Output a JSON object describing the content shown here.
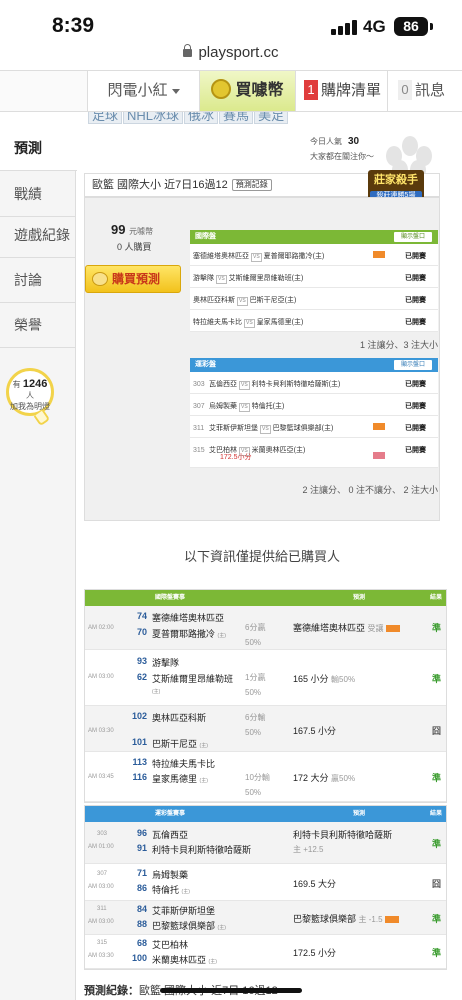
{
  "status": {
    "time": "8:39",
    "network": "4G",
    "battery": "86"
  },
  "browser": {
    "url": "playsport.cc"
  },
  "nav": {
    "user": "閃電小紅",
    "buy": "買噱幣",
    "cart_count": "1",
    "cart": "購牌清單",
    "msg_count": "0",
    "msg": "訊息"
  },
  "sport_tags": [
    "足球",
    "NHL冰球",
    "俄冰",
    "賽馬",
    "美足"
  ],
  "sidebar": {
    "items": [
      "預測",
      "戰績",
      "遊戲紀錄",
      "討論",
      "榮譽"
    ],
    "bulb_prefix": "有",
    "bulb_count": "1246",
    "bulb_suffix": "人",
    "bulb_text": "加我為明燈"
  },
  "header": {
    "visitors_label": "今日人氣",
    "visitors_count": "30",
    "visitors_sub": "大家都在關注你～"
  },
  "prediction": {
    "title": "歐籃 國際大小 近7日16過12",
    "tag": "預測記錄",
    "champion": "莊家殺手",
    "champion_sub": "殺莊連勝5場",
    "price": "99",
    "price_unit": "元噱幣",
    "bought": "0 人購買",
    "buy_button": "購買預測"
  },
  "intl_box": {
    "title": "國際盤",
    "button": "顯示盤口",
    "rows": [
      {
        "away": "塞德維塔奧林匹亞",
        "home": "夏普爾耶路撒冷(主)",
        "status": "已開賽",
        "mini": true
      },
      {
        "away": "游擊隊",
        "home": "艾斯維爾里昂維勒班(主)",
        "status": "已開賽",
        "mini": false
      },
      {
        "away": "奧林匹亞科斯",
        "home": "巴斯干尼亞(主)",
        "status": "已開賽",
        "mini": false
      },
      {
        "away": "特拉維夫馬卡比",
        "home": "皇家馬德里(主)",
        "status": "已開賽",
        "mini": false
      }
    ],
    "summary": "1 注讓分、3 注大小"
  },
  "lottery_box": {
    "title": "運彩盤",
    "button": "顯示盤口",
    "rows": [
      {
        "num": "303",
        "away": "瓦倫西亞",
        "home": "利特卡貝利斯特徹哈薩斯(主)",
        "status": "已開賽",
        "mini": false,
        "extra": ""
      },
      {
        "num": "307",
        "away": "烏姆製藥",
        "home": "特倫托(主)",
        "status": "已開賽",
        "mini": false,
        "extra": ""
      },
      {
        "num": "311",
        "away": "艾菲斯伊斯坦堡",
        "home": "巴黎籃球俱樂部(主)",
        "status": "已開賽",
        "mini": true,
        "extra": ""
      },
      {
        "num": "315",
        "away": "艾巴柏林",
        "home": "米蘭奧林匹亞(主)",
        "status": "已開賽",
        "mini": true,
        "extra": "172.5小分"
      }
    ],
    "summary": "2 注讓分、 0 注不讓分、 2 注大小"
  },
  "info_line": "以下資訊僅提供給已購買人",
  "intl_table": {
    "headers": [
      "國際盤賽事",
      "預測",
      "結果"
    ],
    "rows": [
      {
        "time": "AM 02:00",
        "n1": "74",
        "t1": "塞德維塔奧林匹亞",
        "n2": "70",
        "t2": "夏普爾耶路撒冷",
        "t2tag": "(主)",
        "hc1": "6分贏",
        "hc2": "50%",
        "pred": "塞德維塔奧林匹亞",
        "pred_extra": "受讓",
        "tag": true,
        "result": "準"
      },
      {
        "time": "AM 03:00",
        "n1": "93",
        "t1": "游擊隊",
        "n2": "62",
        "t2": "艾斯維爾里昂維勒班",
        "t2tag": "(主)",
        "hc1": "1分贏",
        "hc2": "50%",
        "pred": "165 小分",
        "pred_extra": "輸50%",
        "tag": false,
        "result": "準"
      },
      {
        "time": "AM 03:30",
        "n1": "102",
        "t1": "奧林匹亞科斯",
        "n2": "101",
        "t2": "巴斯干尼亞",
        "t2tag": "(主)",
        "hc1": "6分輸",
        "hc2": "50%",
        "pred": "167.5 小分",
        "pred_extra": "",
        "tag": false,
        "result": "囧"
      },
      {
        "time": "AM 03:45",
        "n1": "113",
        "t1": "特拉維夫馬卡比",
        "n2": "116",
        "t2": "皇家馬德里",
        "t2tag": "(主)",
        "hc1": "10分輸",
        "hc2": "50%",
        "pred": "172 大分",
        "pred_extra": "贏50%",
        "tag": false,
        "result": "準"
      }
    ]
  },
  "lottery_table": {
    "headers": [
      "運彩盤賽事",
      "預測",
      "結果"
    ],
    "rows": [
      {
        "num": "303",
        "time": "AM 01:00",
        "n1": "96",
        "t1": "瓦倫西亞",
        "n2": "91",
        "t2": "利特卡貝利斯特徹哈薩斯",
        "t2tag": "",
        "pred": "利特卡貝利斯特徹哈薩斯",
        "pred2": "主 +12.5",
        "tag": false,
        "result": "準"
      },
      {
        "num": "307",
        "time": "AM 03:00",
        "n1": "71",
        "t1": "烏姆製藥",
        "n2": "86",
        "t2": "特倫托",
        "t2tag": "(主)",
        "pred": "169.5 大分",
        "pred2": "",
        "tag": false,
        "result": "囧"
      },
      {
        "num": "311",
        "time": "AM 03:00",
        "n1": "84",
        "t1": "艾菲斯伊斯坦堡",
        "n2": "88",
        "t2": "巴黎籃球俱樂部",
        "t2tag": "(主)",
        "pred": "巴黎籃球俱樂部",
        "pred2": "主 -1.5",
        "tag": true,
        "result": "準"
      },
      {
        "num": "315",
        "time": "AM 03:30",
        "n1": "68",
        "t1": "艾巴柏林",
        "n2": "100",
        "t2": "米蘭奧林匹亞",
        "t2tag": "(主)",
        "pred": "172.5 小分",
        "pred2": "",
        "tag": false,
        "result": "準"
      }
    ]
  },
  "footer": {
    "label": "預測紀錄：",
    "text": "歐籃 國際大小 近7日 16過12"
  },
  "colors": {
    "green": "#7cb836",
    "blue": "#3b97d8",
    "win": "#3a9c2e",
    "red": "#e03c3c"
  }
}
